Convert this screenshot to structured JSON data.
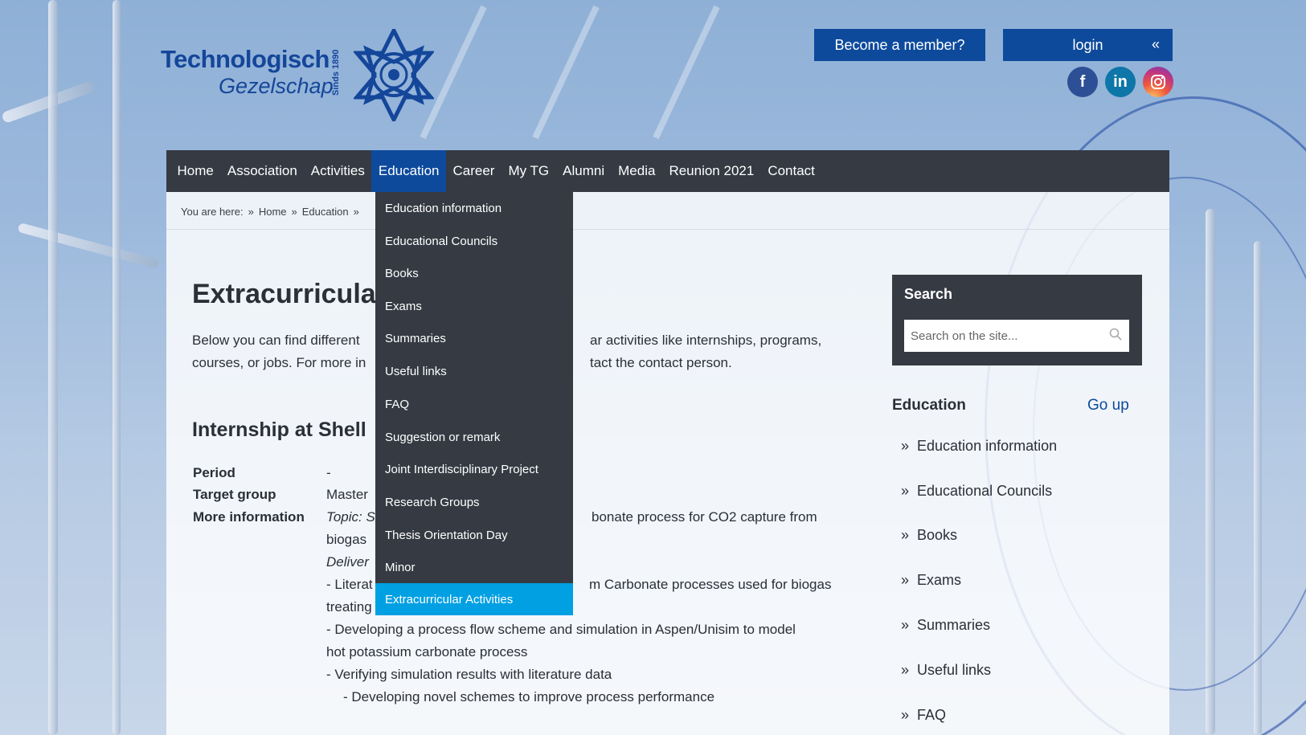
{
  "header": {
    "logo_line1": "Technologisch",
    "logo_line2": "Gezelschap",
    "logo_since": "Sinds 1890",
    "member_button": "Become a member?",
    "login_button": "login",
    "login_chevron": "«",
    "social": [
      "facebook-icon",
      "linkedin-icon",
      "instagram-icon"
    ]
  },
  "nav": {
    "items": [
      "Home",
      "Association",
      "Activities",
      "Education",
      "Career",
      "My TG",
      "Alumni",
      "Media",
      "Reunion 2021",
      "Contact"
    ],
    "active": "Education"
  },
  "dropdown": {
    "items": [
      "Education information",
      "Educational Councils",
      "Books",
      "Exams",
      "Summaries",
      "Useful links",
      "FAQ",
      "Suggestion or remark",
      "Joint Interdisciplinary Project",
      "Research Groups",
      "Thesis Orientation Day",
      "Minor",
      "Extracurricular Activities"
    ],
    "active": "Extracurricular Activities"
  },
  "breadcrumb": {
    "prefix": "You are here:",
    "sep": "»",
    "items": [
      "Home",
      "Education"
    ]
  },
  "main": {
    "title": "Extracurricula",
    "intro_left_1": "Below you can find different",
    "intro_right_1": "ar activities like internships, programs,",
    "intro_left_2": "courses, or jobs. For more in",
    "intro_right_2": "tact the contact person.",
    "section_title": "Internship at Shell",
    "rows": [
      {
        "label": "Period",
        "value": "-"
      },
      {
        "label": "Target group",
        "value": "Master"
      },
      {
        "label": "More information",
        "value": ""
      }
    ],
    "topic_prefix": "Topic: S",
    "topic_right": "bonate process for CO2 capture from",
    "line_biogas": "biogas",
    "deliverables_prefix": "Deliver",
    "lit_left": "- Literat",
    "lit_right": "m Carbonate processes used for biogas",
    "treating": "treating",
    "dev1": "- Developing a process flow scheme and simulation in Aspen/Unisim to model",
    "dev1b": "hot potassium carbonate process",
    "verify": "- Verifying simulation results with literature data",
    "dev2": "- Developing novel schemes to improve process performance"
  },
  "sidebar": {
    "search_title": "Search",
    "search_placeholder": "Search on the site...",
    "search_icon": "search-icon",
    "section_title": "Education",
    "go_up": "Go up",
    "items": [
      "Education information",
      "Educational Councils",
      "Books",
      "Exams",
      "Summaries",
      "Useful links",
      "FAQ"
    ]
  },
  "colors": {
    "brand_blue": "#0d4a9c",
    "nav_dark": "#353a43",
    "active_dropdown": "#00a0e3"
  }
}
